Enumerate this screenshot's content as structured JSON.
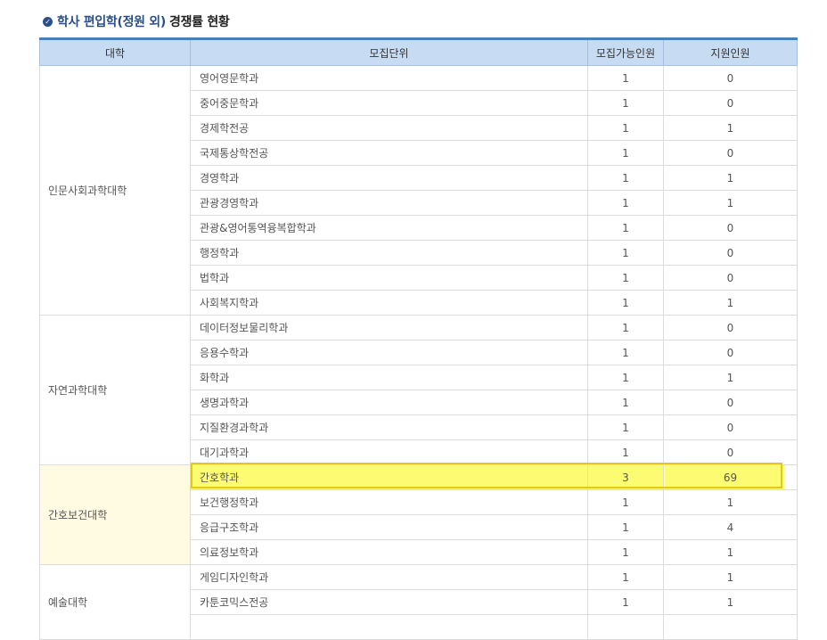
{
  "heading": {
    "icon": "check-circle-icon",
    "accent_text": "학사 편입학(정원 외)",
    "rest_text": "경쟁률 현황"
  },
  "table": {
    "headers": [
      "대학",
      "모집단위",
      "모집가능인원",
      "지원인원"
    ],
    "groups": [
      {
        "college": "인문사회과학대학",
        "rows": [
          {
            "unit": "영어영문학과",
            "capacity": "1",
            "applicants": "0"
          },
          {
            "unit": "중어중문학과",
            "capacity": "1",
            "applicants": "0"
          },
          {
            "unit": "경제학전공",
            "capacity": "1",
            "applicants": "1"
          },
          {
            "unit": "국제통상학전공",
            "capacity": "1",
            "applicants": "0"
          },
          {
            "unit": "경영학과",
            "capacity": "1",
            "applicants": "1"
          },
          {
            "unit": "관광경영학과",
            "capacity": "1",
            "applicants": "1"
          },
          {
            "unit": "관광&영어통역융복합학과",
            "capacity": "1",
            "applicants": "0"
          },
          {
            "unit": "행정학과",
            "capacity": "1",
            "applicants": "0"
          },
          {
            "unit": "법학과",
            "capacity": "1",
            "applicants": "0"
          },
          {
            "unit": "사회복지학과",
            "capacity": "1",
            "applicants": "1"
          }
        ]
      },
      {
        "college": "자연과학대학",
        "rows": [
          {
            "unit": "데이터정보물리학과",
            "capacity": "1",
            "applicants": "0"
          },
          {
            "unit": "응용수학과",
            "capacity": "1",
            "applicants": "0"
          },
          {
            "unit": "화학과",
            "capacity": "1",
            "applicants": "1"
          },
          {
            "unit": "생명과학과",
            "capacity": "1",
            "applicants": "0"
          },
          {
            "unit": "지질환경과학과",
            "capacity": "1",
            "applicants": "0"
          },
          {
            "unit": "대기과학과",
            "capacity": "1",
            "applicants": "0"
          }
        ]
      },
      {
        "college": "간호보건대학",
        "highlight_college": true,
        "rows": [
          {
            "unit": "간호학과",
            "capacity": "3",
            "applicants": "69",
            "highlight": true
          },
          {
            "unit": "보건행정학과",
            "capacity": "1",
            "applicants": "1"
          },
          {
            "unit": "응급구조학과",
            "capacity": "1",
            "applicants": "4"
          },
          {
            "unit": "의료정보학과",
            "capacity": "1",
            "applicants": "1"
          }
        ]
      },
      {
        "college": "예술대학",
        "rows": [
          {
            "unit": "게임디자인학과",
            "capacity": "1",
            "applicants": "1"
          },
          {
            "unit": "카툰코믹스전공",
            "capacity": "1",
            "applicants": "1"
          },
          {
            "unit": "",
            "capacity": "",
            "applicants": ""
          }
        ]
      }
    ]
  },
  "colors": {
    "header_bg": "#c7dcf3",
    "header_top_border": "#4d7ebc",
    "highlight_yellow": "#fcfb72",
    "highlight_border": "#e3c71a",
    "college_highlight_bg": "#fffbe2",
    "title_accent": "#2a4f8a"
  }
}
